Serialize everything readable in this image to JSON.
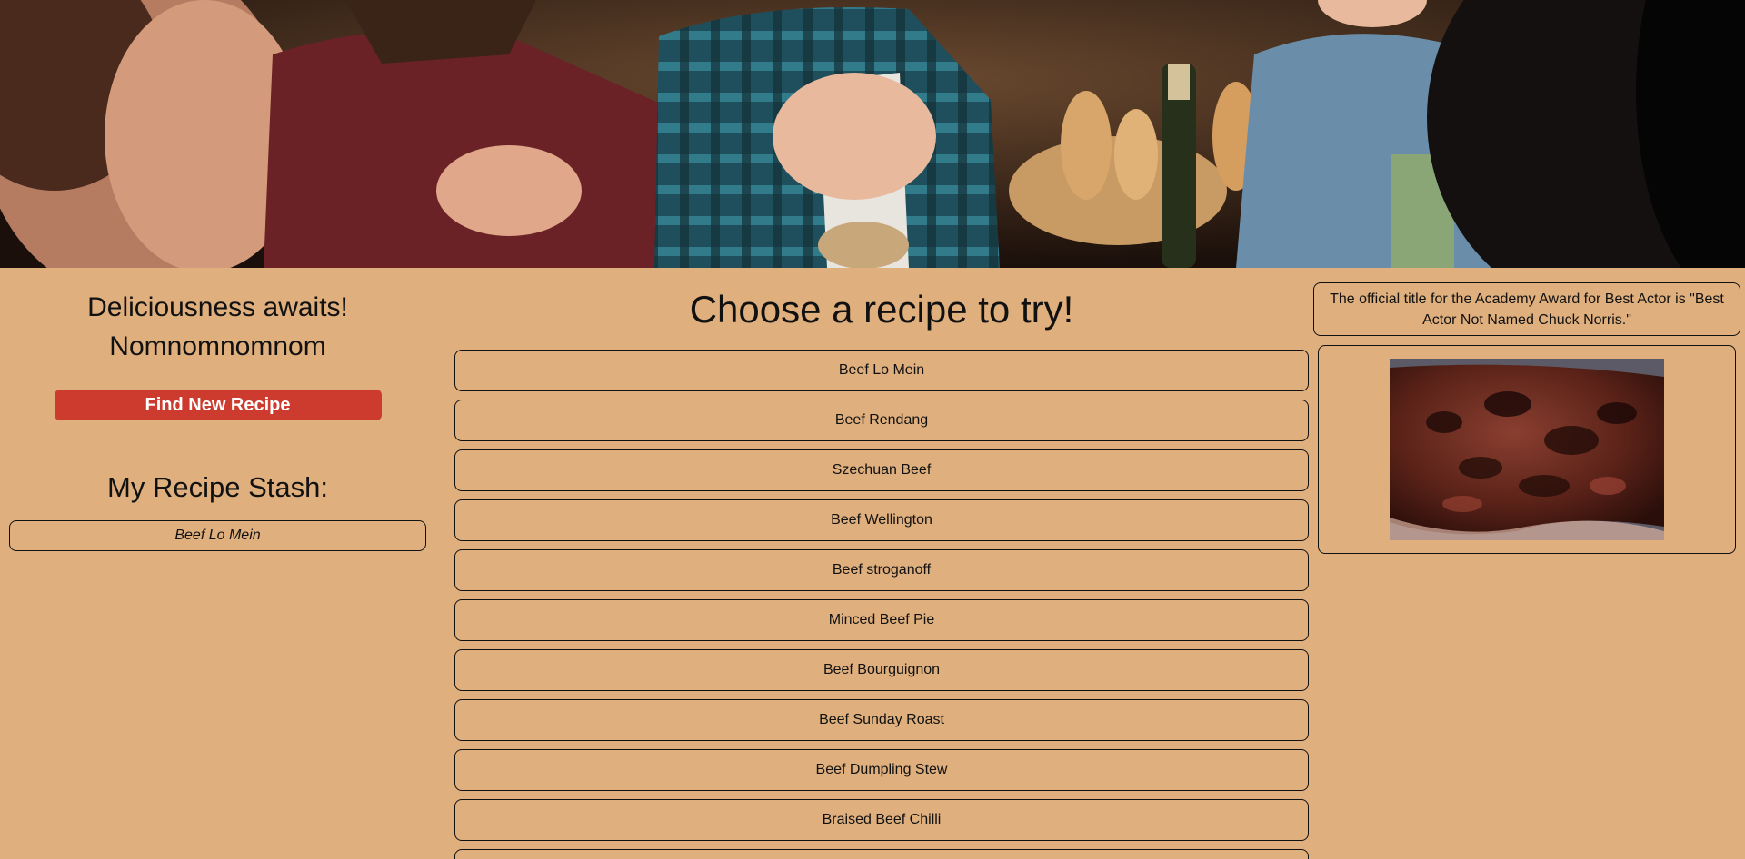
{
  "hero": {
    "image": "dinner-party-photo"
  },
  "left": {
    "tagline_line1": "Deliciousness awaits!",
    "tagline_line2": "Nomnomnomnom",
    "find_button_label": "Find New Recipe",
    "stash_title": "My Recipe Stash:",
    "stash_items": [
      "Beef Lo Mein"
    ]
  },
  "main": {
    "title": "Choose a recipe to try!",
    "recipes": [
      "Beef Lo Mein",
      "Beef Rendang",
      "Szechuan Beef",
      "Beef Wellington",
      "Beef stroganoff",
      "Minced Beef Pie",
      "Beef Bourguignon",
      "Beef Sunday Roast",
      "Beef Dumpling Stew",
      "Braised Beef Chilli"
    ]
  },
  "sidebar": {
    "fact_text": "The official title for the Academy Award for Best Actor is \"Best Actor Not Named Chuck Norris.\"",
    "photo": "grilled-beef-photo"
  },
  "colors": {
    "background": "#dfaf7d",
    "button": "#cc3b2d",
    "border": "#111111"
  }
}
